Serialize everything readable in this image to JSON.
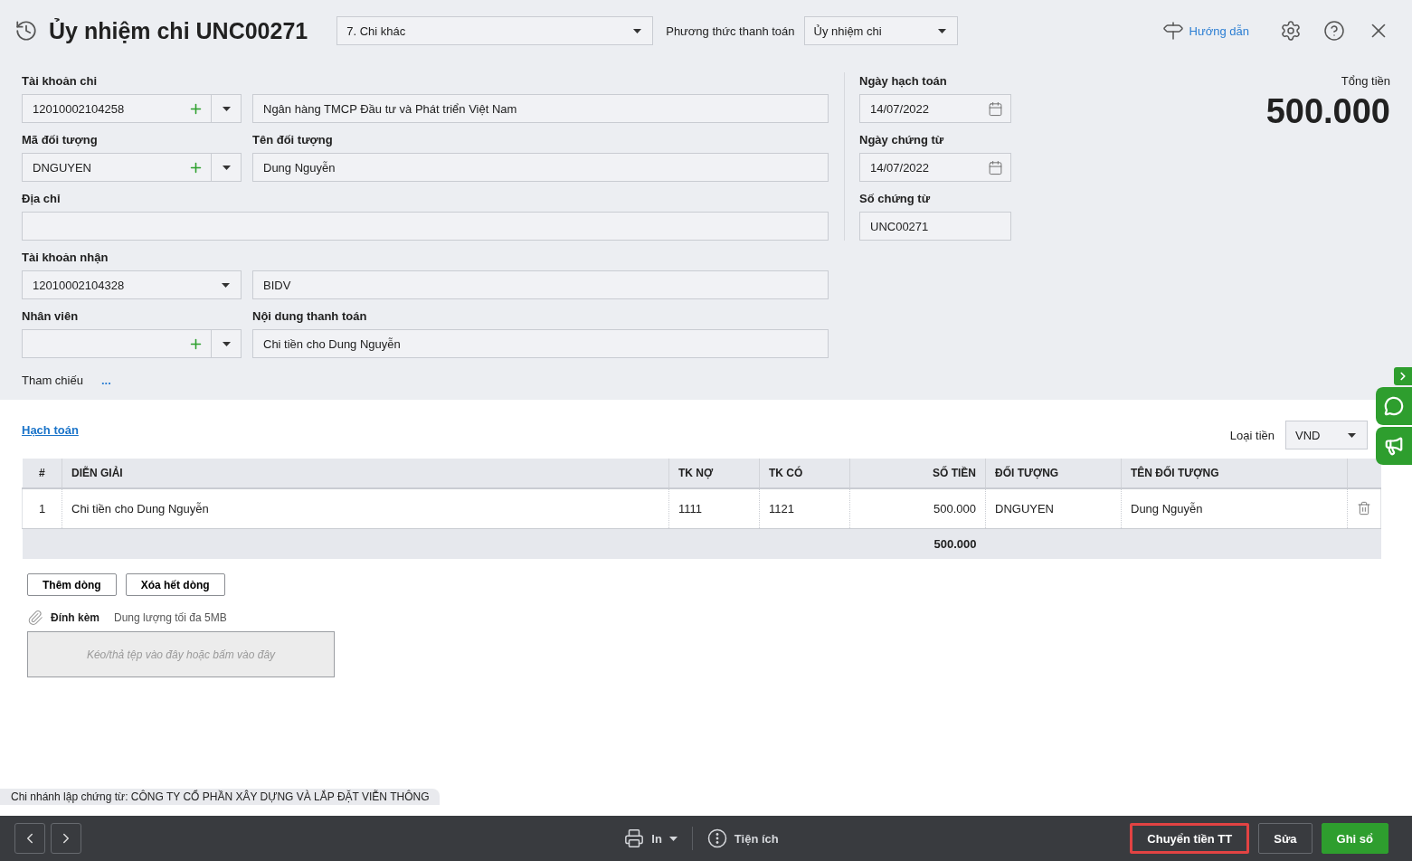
{
  "header": {
    "title": "Ủy nhiệm chi UNC00271",
    "voucher_type": "7. Chi khác",
    "payment_method_label": "Phương thức thanh toán",
    "payment_method": "Ủy nhiệm chi",
    "guide": "Hướng dẫn"
  },
  "form": {
    "rows": [
      {
        "fields": [
          {
            "kind": "combo_add",
            "label": "Tài khoản chi",
            "value": "12010002104258"
          },
          {
            "kind": "text",
            "value": "Ngân hàng TMCP Đầu tư và Phát triển Việt Nam"
          }
        ]
      },
      {
        "fields": [
          {
            "kind": "combo_add",
            "label": "Mã đối tượng",
            "value": "DNGUYEN"
          },
          {
            "kind": "text",
            "label": "Tên đối tượng",
            "value": "Dung Nguyễn"
          }
        ]
      },
      {
        "fields": [
          {
            "kind": "text",
            "label": "Địa chỉ"
          }
        ]
      },
      {
        "fields": [
          {
            "kind": "select",
            "label": "Tài khoản nhận",
            "value": "12010002104328"
          },
          {
            "kind": "text",
            "value": "BIDV"
          }
        ]
      },
      {
        "fields": [
          {
            "kind": "combo_add",
            "label": "Nhân viên"
          },
          {
            "kind": "text",
            "label": "Nội dung thanh toán",
            "value": "Chi tiền cho Dung Nguyễn"
          }
        ]
      }
    ],
    "reference": {
      "label": "Tham chiếu",
      "action": "..."
    },
    "side_fields": [
      {
        "kind": "date",
        "label": "Ngày hạch toán",
        "value": "14/07/2022"
      },
      {
        "kind": "date",
        "label": "Ngày chứng từ",
        "value": "14/07/2022"
      },
      {
        "kind": "text",
        "label": "Số chứng từ",
        "value": "UNC00271"
      }
    ],
    "total": {
      "label": "Tổng tiền",
      "amount": "500.000"
    }
  },
  "accounting": {
    "link": "Hạch toán",
    "currency_label": "Loại tiền",
    "currency": "VND",
    "columns": [
      {
        "label": "#",
        "kind": "index"
      },
      {
        "label": "DIỄN GIẢI",
        "kind": "text"
      },
      {
        "label": "TK NỢ",
        "kind": "text"
      },
      {
        "label": "TK CÓ",
        "kind": "text"
      },
      {
        "label": "SỐ TIỀN",
        "kind": "amount"
      },
      {
        "label": "ĐỐI TƯỢNG",
        "kind": "text"
      },
      {
        "label": "TÊN ĐỐI TƯỢNG",
        "kind": "text"
      }
    ],
    "rows": [
      [
        "1",
        "Chi tiền cho Dung Nguyễn",
        "1111",
        "1121",
        "500.000",
        "DNGUYEN",
        "Dung Nguyễn"
      ]
    ],
    "total": "500.000",
    "buttons": [
      "Thêm dòng",
      "Xóa hết dòng"
    ]
  },
  "attachment": {
    "label": "Đính kèm",
    "hint": "Dung lượng tối đa 5MB",
    "dropzone": "Kéo/thả tệp vào đây hoặc bấm vào đây"
  },
  "branch_note": "Chi nhánh lập chứng từ: CÔNG TY CỔ PHẦN XÂY DỰNG VÀ LẮP ĐẶT VIỄN THÔNG",
  "footer": {
    "print": "In",
    "utilities": "Tiện ích",
    "actions": [
      {
        "label": "Chuyển tiền TT",
        "kind": "dark",
        "highlighted": true
      },
      {
        "label": "Sửa",
        "kind": "dark",
        "highlighted": false
      },
      {
        "label": "Ghi sổ",
        "kind": "primary",
        "highlighted": false
      }
    ]
  }
}
